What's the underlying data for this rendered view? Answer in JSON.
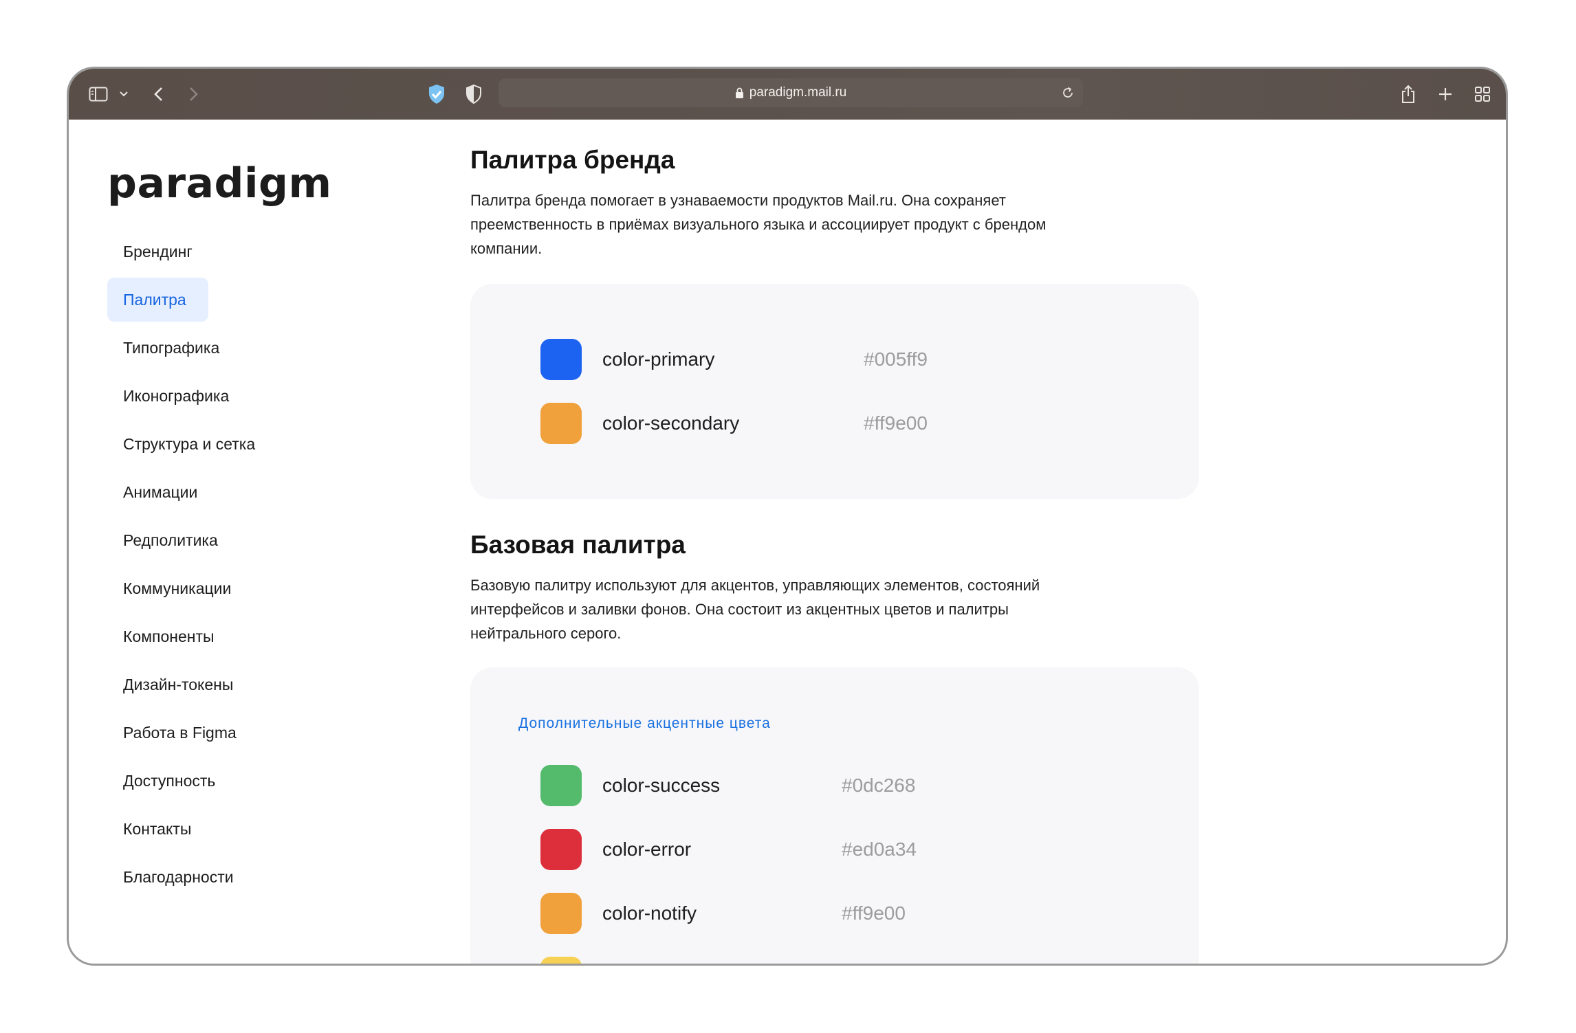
{
  "browser": {
    "url": "paradigm.mail.ru",
    "icons": [
      "sidebar-icon",
      "chevron-down-icon",
      "back-icon",
      "forward-icon",
      "shield-check-icon",
      "privacy-shield-icon",
      "lock-icon",
      "reload-icon",
      "share-icon",
      "new-tab-icon",
      "tab-overview-icon"
    ]
  },
  "sidebar": {
    "logo": "paradigm",
    "items": [
      {
        "label": "Брендинг",
        "active": false
      },
      {
        "label": "Палитра",
        "active": true
      },
      {
        "label": "Типографика",
        "active": false
      },
      {
        "label": "Иконографика",
        "active": false
      },
      {
        "label": "Структура и сетка",
        "active": false
      },
      {
        "label": "Анимации",
        "active": false
      },
      {
        "label": "Редполитика",
        "active": false
      },
      {
        "label": "Коммуникации",
        "active": false
      },
      {
        "label": "Компоненты",
        "active": false
      },
      {
        "label": "Дизайн-токены",
        "active": false
      },
      {
        "label": "Работа в Figma",
        "active": false
      },
      {
        "label": "Доступность",
        "active": false
      },
      {
        "label": "Контакты",
        "active": false
      },
      {
        "label": "Благодарности",
        "active": false
      }
    ]
  },
  "brand_palette": {
    "title": "Палитра бренда",
    "description": "Палитра бренда помогает в узнаваемости продуктов Mail.ru. Она сохраняет преемственность в приёмах визуального языка и ассоциирует продукт с брендом компании.",
    "colors": [
      {
        "token": "color-primary",
        "hex": "#005ff9",
        "swatch": "#1d63f2"
      },
      {
        "token": "color-secondary",
        "hex": "#ff9e00",
        "swatch": "#f1a13c"
      }
    ]
  },
  "base_palette": {
    "title": "Базовая палитра",
    "description": "Базовую палитру используют для акцентов, управляющих элементов, состояний интерфейсов и  заливки фонов. Она состоит из акцентных цветов и палитры нейтрального серого.",
    "subheading": "Дополнительные акцентные цвета",
    "colors": [
      {
        "token": "color-success",
        "hex": "#0dc268",
        "swatch": "#54bb6c"
      },
      {
        "token": "color-error",
        "hex": "#ed0a34",
        "swatch": "#dd2f3b"
      },
      {
        "token": "color-notify",
        "hex": "#ff9e00",
        "swatch": "#f1a13c"
      },
      {
        "token": "",
        "hex": "",
        "swatch": "#f6d153"
      }
    ]
  }
}
